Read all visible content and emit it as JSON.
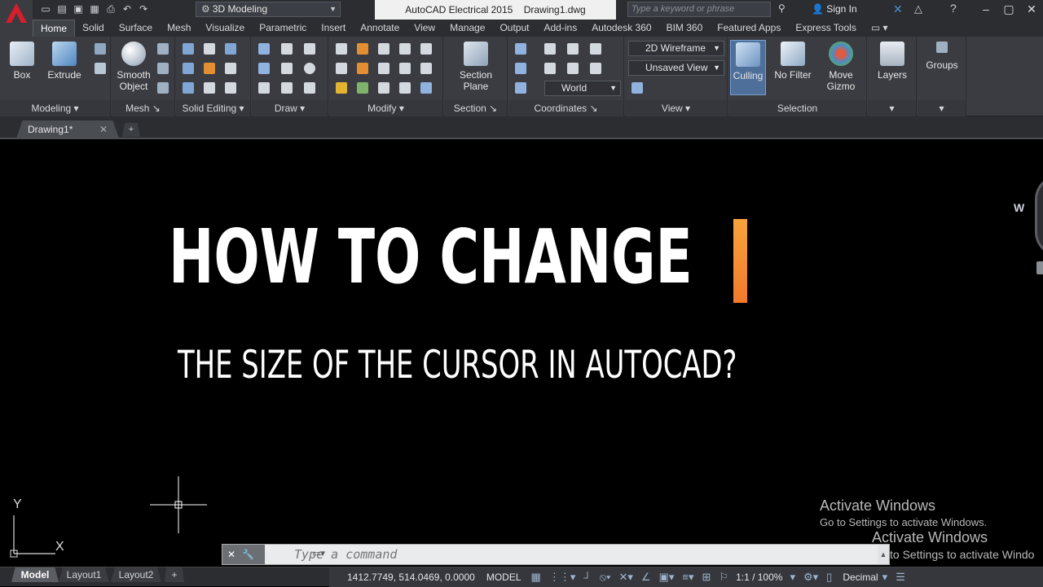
{
  "app": {
    "workspace": "3D Modeling",
    "title": "AutoCAD Electrical 2015",
    "filename": "Drawing1.dwg",
    "search_placeholder": "Type a keyword or phrase",
    "sign_in": "Sign In"
  },
  "tabs": [
    "Home",
    "Solid",
    "Surface",
    "Mesh",
    "Visualize",
    "Parametric",
    "Insert",
    "Annotate",
    "View",
    "Manage",
    "Output",
    "Add-ins",
    "Autodesk 360",
    "BIM 360",
    "Featured Apps",
    "Express Tools"
  ],
  "ribbon": {
    "modeling": {
      "title": "Modeling",
      "box": "Box",
      "extrude": "Extrude"
    },
    "mesh": {
      "title": "Mesh",
      "smooth_line1": "Smooth",
      "smooth_line2": "Object"
    },
    "solid_editing": {
      "title": "Solid Editing"
    },
    "draw": {
      "title": "Draw"
    },
    "modify": {
      "title": "Modify"
    },
    "section": {
      "title": "Section",
      "plane_line1": "Section",
      "plane_line2": "Plane"
    },
    "coordinates": {
      "title": "Coordinates",
      "world": "World"
    },
    "view": {
      "title": "View",
      "visual_style": "2D Wireframe",
      "saved_view": "Unsaved View"
    },
    "selection": {
      "title": "Selection",
      "culling": "Culling",
      "nofilter": "No Filter",
      "gizmo_line1": "Move",
      "gizmo_line2": "Gizmo"
    },
    "layers": {
      "title": "Layers"
    },
    "groups": {
      "title": "Groups"
    }
  },
  "doc_tab": {
    "label": "Drawing1*"
  },
  "canvas": {
    "headline": "HOW TO CHANGE",
    "subline": "THE SIZE  OF THE CURSOR IN AUTOCAD?",
    "ucs_y": "Y",
    "ucs_x": "X",
    "nav_w": "W",
    "watermark1": "Activate Windows",
    "watermark2": "Go to Settings to activate Windows.",
    "watermark3": "Activate Windows",
    "watermark4": "to Settings to activate Windo"
  },
  "command": {
    "placeholder": "Type a command"
  },
  "status": {
    "layouts": [
      "Model",
      "Layout1",
      "Layout2"
    ],
    "coords": "1412.7749, 514.0469, 0.0000",
    "model": "MODEL",
    "scale": "1:1 / 100%",
    "units": "Decimal"
  },
  "colors": {
    "accent_orange": "#f17a2c",
    "app_red": "#c8102e",
    "ribbon_bg": "#3a3c41"
  }
}
